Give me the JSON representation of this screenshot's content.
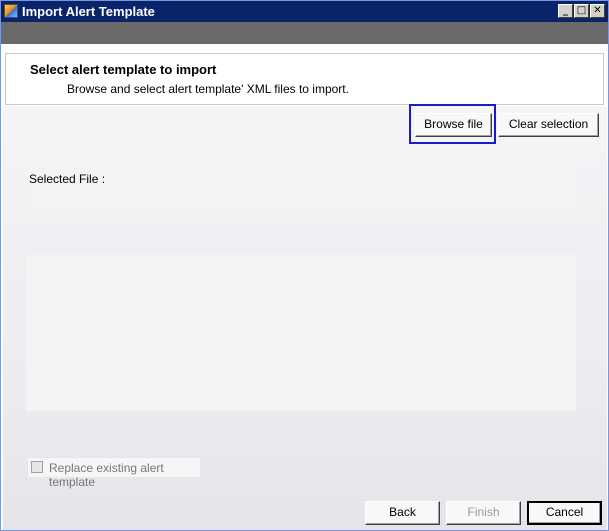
{
  "window": {
    "title": "Import Alert Template",
    "minimize_glyph": "_",
    "maximize_glyph": "□",
    "close_glyph": "✕"
  },
  "header": {
    "title": "Select alert template to import",
    "subtitle": "Browse and select alert template' XML files to import."
  },
  "toolbar": {
    "browse_label": "Browse file",
    "clear_label": "Clear selection"
  },
  "selected_file": {
    "label": "Selected File :"
  },
  "replace_option": {
    "label": "Replace existing alert template",
    "checked": false,
    "enabled": false
  },
  "footer": {
    "back_label": "Back",
    "finish_label": "Finish",
    "cancel_label": "Cancel"
  },
  "colors": {
    "titlebar": "#0a246a",
    "focus_ring": "#1a1acc"
  }
}
